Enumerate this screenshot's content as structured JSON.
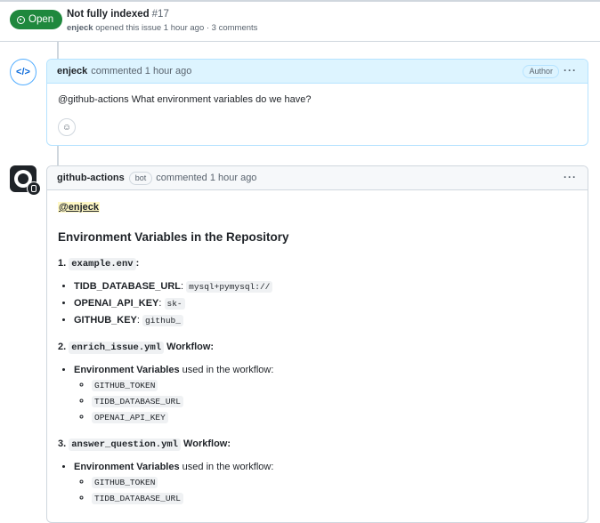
{
  "header": {
    "status": "Open",
    "title": "Not fully indexed",
    "number": "#17",
    "opener": "enjeck",
    "meta": "opened this issue 1 hour ago · 3 comments"
  },
  "comment1": {
    "author": "enjeck",
    "action": "commented 1 hour ago",
    "role_label": "Author",
    "body": "@github-actions What environment variables do we have?"
  },
  "comment2": {
    "author": "github-actions",
    "bot_label": "bot",
    "action": "commented 1 hour ago",
    "mention": "@enjeck",
    "heading": "Environment Variables in the Repository",
    "sections": [
      {
        "num": "1.",
        "file": "example.env",
        "suffix": ":",
        "items": [
          {
            "key": "TIDB_DATABASE_URL",
            "sep": ":",
            "value": "mysql+pymysql://"
          },
          {
            "key": "OPENAI_API_KEY",
            "sep": ":",
            "value": "sk-"
          },
          {
            "key": "GITHUB_KEY",
            "sep": ":",
            "value": "github_"
          }
        ]
      },
      {
        "num": "2.",
        "file": "enrich_issue.yml",
        "suffix": "Workflow:",
        "env_label": "Environment Variables",
        "env_text": "used in the workflow:",
        "vars": [
          "GITHUB_TOKEN",
          "TIDB_DATABASE_URL",
          "OPENAI_API_KEY"
        ]
      },
      {
        "num": "3.",
        "file": "answer_question.yml",
        "suffix": "Workflow:",
        "env_label": "Environment Variables",
        "env_text": "used in the workflow:",
        "vars": [
          "GITHUB_TOKEN",
          "TIDB_DATABASE_URL"
        ]
      }
    ]
  }
}
